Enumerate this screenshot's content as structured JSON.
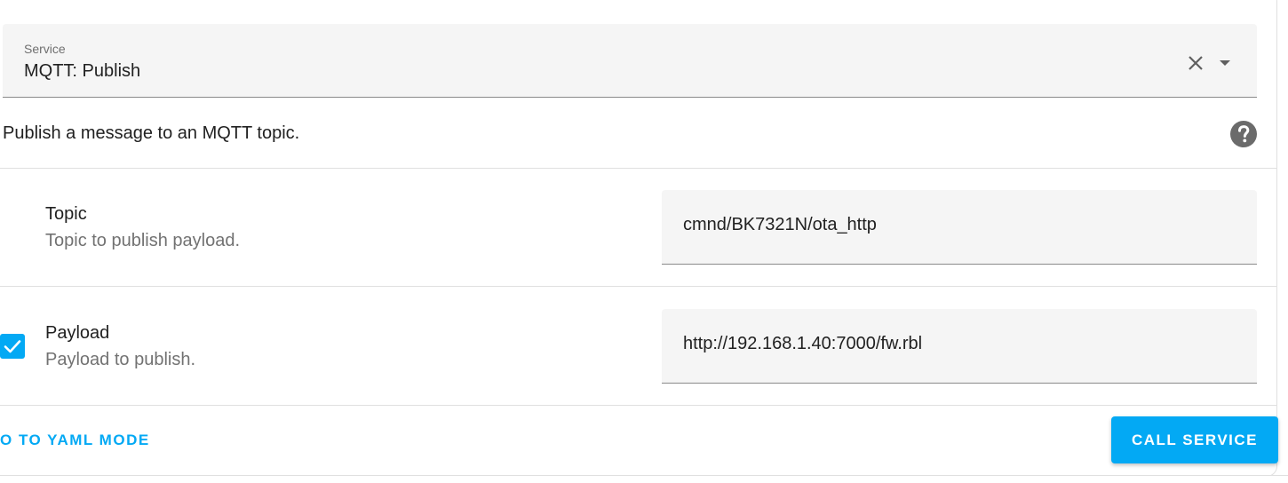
{
  "service": {
    "label": "Service",
    "value": "MQTT: Publish"
  },
  "description": "Publish a message to an MQTT topic.",
  "fields": [
    {
      "title": "Topic",
      "subtitle": "Topic to publish payload.",
      "value": "cmnd/BK7321N/ota_http"
    },
    {
      "title": "Payload",
      "subtitle": "Payload to publish.",
      "value": "http://192.168.1.40:7000/fw.rbl",
      "checked": true
    }
  ],
  "footer": {
    "yaml_link": "O TO YAML MODE",
    "call_button": "CALL SERVICE"
  },
  "colors": {
    "accent": "#03a9f4",
    "field_bg": "#f5f5f5",
    "divider": "#e0e0e0"
  },
  "icons": {
    "clear": "close-icon",
    "dropdown": "menu-down-icon",
    "help": "help-circle-icon",
    "check": "check-icon"
  }
}
